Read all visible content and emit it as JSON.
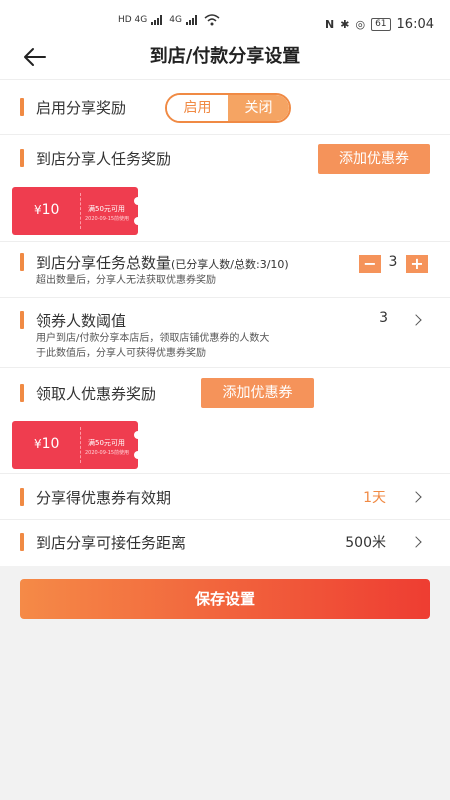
{
  "status_bar": {
    "net_left": "HD 4G",
    "net_right": "4G",
    "battery": "61",
    "time": "16:04"
  },
  "header": {
    "title": "到店/付款分享设置"
  },
  "enable_reward": {
    "label": "启用分享奖励",
    "on_label": "启用",
    "off_label": "关闭",
    "selected": "关闭"
  },
  "task_reward": {
    "label": "到店分享人任务奖励",
    "add_label": "添加优惠券",
    "coupon": {
      "currency": "¥",
      "amount": "10",
      "condition": "满50元可用",
      "valid": "2020-09-15前使用"
    }
  },
  "task_total": {
    "label": "到店分享任务总数量",
    "sub": "(已分享人数/总数:3/10)",
    "desc": "超出数量后，分享人无法获取优惠券奖励",
    "minus": "−",
    "plus": "+",
    "value": "3"
  },
  "threshold": {
    "label": "领券人数阈值",
    "desc_line1": "用户到店/付款分享本店后，领取店铺优惠券的人数大",
    "desc_line2": "于此数值后，分享人可获得优惠券奖励",
    "value": "3"
  },
  "receiver_reward": {
    "label": "领取人优惠券奖励",
    "add_label": "添加优惠券",
    "coupon": {
      "currency": "¥",
      "amount": "10",
      "condition": "满50元可用",
      "valid": "2020-09-15前使用"
    }
  },
  "validity": {
    "label": "分享得优惠券有效期",
    "value": "1天"
  },
  "distance": {
    "label": "到店分享可接任务距离",
    "value": "500米"
  },
  "save_label": "保存设置",
  "colors": {
    "accent": "#f08a44",
    "coupon": "#ef3d4f",
    "value_highlight": "#f08a44"
  }
}
